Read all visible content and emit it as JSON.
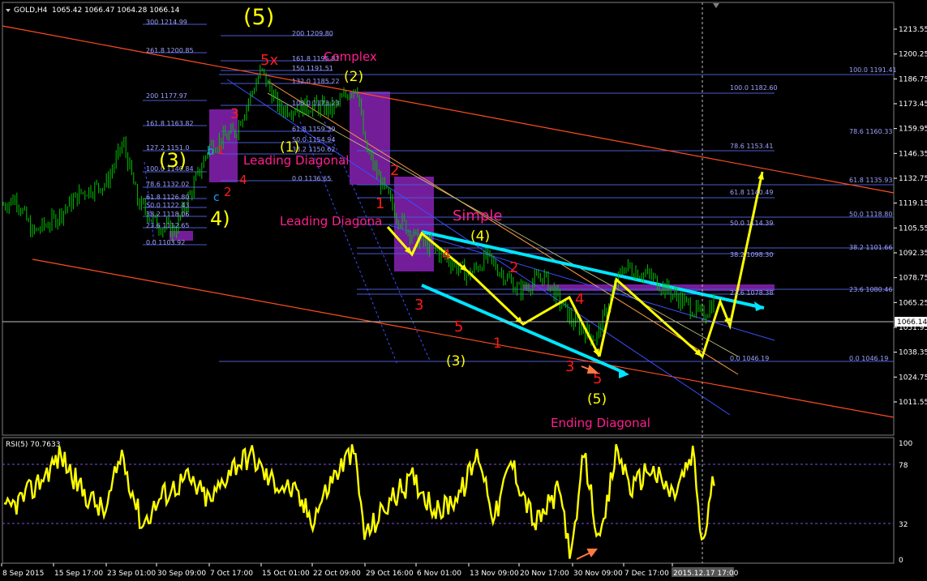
{
  "header": {
    "symbol": "GOLD,H4",
    "ohlc": "1065.42 1066.47 1064.28 1066.14"
  },
  "rsi_header": "RSI(5) 70.7633",
  "colors": {
    "background": "#000000",
    "candles": "#00c000",
    "fib_lines": "#4a5cd0",
    "fib_text": "#a0a0ff",
    "channel": "#ff4d1f",
    "wave_arrows": "#ffff00",
    "trendline": "#00e5ff",
    "rect": "#7a1fa2",
    "label_red": "#ff1a1a",
    "label_pink": "#ff1f8f",
    "label_yellow": "#ffff00",
    "rsi_line": "#ffff00"
  },
  "price_axis": {
    "ticks": [
      "1213.55",
      "1200.25",
      "1186.75",
      "1173.45",
      "1159.95",
      "1146.35",
      "1132.75",
      "1119.15",
      "1105.55",
      "1092.35",
      "1078.75",
      "1065.25",
      "1051.95",
      "1038.35",
      "1024.75",
      "1011.55"
    ],
    "current": "1066.14"
  },
  "time_axis": [
    "8 Sep 2015",
    "15 Sep 17:00",
    "23 Sep 01:00",
    "30 Sep 09:00",
    "7 Oct 17:00",
    "15 Oct 01:00",
    "22 Oct 09:00",
    "29 Oct 16:00",
    "6 Nov 01:00",
    "13 Nov 09:00",
    "20 Nov 17:00",
    "30 Nov 09:00",
    "7 Dec 17:00",
    "2015.12.17 17:00"
  ],
  "rsi_axis": [
    "100",
    "78",
    "32",
    "0"
  ],
  "fib_left": [
    "300 1214.99",
    "261.8 1200.85",
    "200 1177.97",
    "161.8 1163.82",
    "127.2 1151.0",
    "100.0 1140.84",
    "78.6 1132.02",
    "61.8 1126.80",
    "50.0 1122.43",
    "38.2 1118.06",
    "23.6 1112.65",
    "0.0 1103.92"
  ],
  "fib_mid": [
    "200 1209.80",
    "161.8 1195.81",
    "150 1191.51",
    "132.0 1185.22",
    "100.0 1173.23",
    "61.8 1159.39",
    "50.0 1154.94",
    "38.2 1150.62",
    "0.0 1136.65"
  ],
  "fib_right_a": [
    "100.0 1182.60",
    "78.6 1153.41",
    "61.8 1140.49",
    "50.0 1114.39",
    "38.2 1098.30",
    "23.6 1078.38",
    "0.0 1046.19"
  ],
  "fib_right_b": [
    "100.0 1191.41",
    "78.6 1160.33",
    "61.8 1135.93",
    "50.0 1118.80",
    "38.2 1101.66",
    "23.6 1080.46",
    "0.0 1046.19"
  ],
  "labels": {
    "top5": "(5)",
    "five_x": "5x",
    "complex": "Complex",
    "w2": "(2)",
    "w1": "(1)",
    "leading1": "Leading Diagonal",
    "leading2": "Leading Diagona",
    "simple": "Simple",
    "w4": "(4)",
    "w3": "(3)",
    "w5b": "(5)",
    "ending": "Ending Diagonal",
    "left3": "(3)",
    "left4": "4)",
    "n3a": "3",
    "n4a": "4",
    "n2a": "2",
    "n1a": "1",
    "n2b": "2",
    "n1b": "1",
    "n3b": "3",
    "n4b": "4",
    "n5b": "5",
    "n1c": "1",
    "n2c": "2",
    "n4c": "4",
    "n3c": "3",
    "n5c": "5",
    "b_letter": "b",
    "c_letter": "c"
  },
  "chart_data": {
    "type": "candlestick",
    "title": "GOLD,H4",
    "ylim": [
      1011.55,
      1213.55
    ],
    "last_close": 1066.14,
    "price_path": [
      {
        "x": "8 Sep 2015",
        "y": 1118
      },
      {
        "x": "15 Sep 17:00",
        "y": 1110
      },
      {
        "x": "23 Sep 01:00",
        "y": 1152
      },
      {
        "x": "30 Sep 09:00",
        "y": 1108
      },
      {
        "x": "7 Oct 17:00",
        "y": 1145
      },
      {
        "x": "15 Oct 01:00",
        "y": 1191
      },
      {
        "x": "22 Oct 09:00",
        "y": 1172
      },
      {
        "x": "29 Oct 16:00",
        "y": 1132
      },
      {
        "x": "6 Nov 01:00",
        "y": 1091
      },
      {
        "x": "13 Nov 09:00",
        "y": 1080
      },
      {
        "x": "20 Nov 17:00",
        "y": 1068
      },
      {
        "x": "30 Nov 09:00",
        "y": 1046
      },
      {
        "x": "7 Dec 17:00",
        "y": 1085
      },
      {
        "x": "2015.12.17 17:00",
        "y": 1066.14
      }
    ],
    "rsi": {
      "name": "RSI(5)",
      "last": 70.7633,
      "ylim": [
        0,
        100
      ],
      "levels": [
        78,
        32
      ]
    }
  }
}
